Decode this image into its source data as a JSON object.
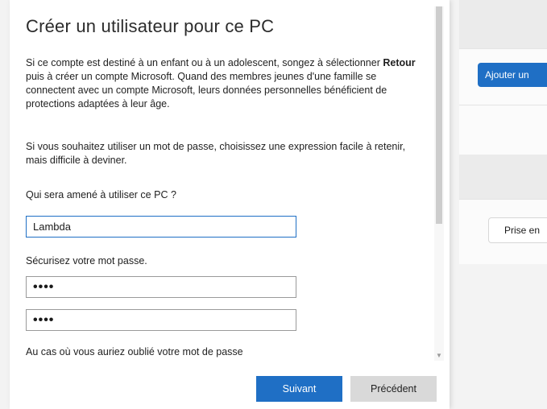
{
  "background": {
    "primary_button": "Ajouter un",
    "secondary_button": "Prise en"
  },
  "dialog": {
    "title": "Créer un utilisateur pour ce PC",
    "intro": {
      "line1_prefix": "Si ce compte est destiné à un enfant ou à un adolescent, songez à sélectionner ",
      "line1_bold": "Retour",
      "line2": "puis à créer un compte Microsoft. Quand des membres jeunes d'une famille se",
      "line3": "connectent avec un compte Microsoft, leurs données personnelles bénéficient de",
      "line4": "protections adaptées à leur âge."
    },
    "password_hint": {
      "line1": "Si vous souhaitez utiliser un mot de passe, choisissez une expression facile à retenir,",
      "line2": "mais difficile à deviner."
    },
    "user_label": "Qui sera amené à utiliser ce PC ?",
    "user_value": "Lambda",
    "password_label": "Sécurisez votre mot passe.",
    "password_value": "••••",
    "password_confirm_value": "••••",
    "forgot_label": "Au cas où vous auriez oublié votre mot de passe",
    "next_button": "Suivant",
    "prev_button": "Précédent"
  },
  "colors": {
    "accent": "#1f6fc5",
    "secondary_button": "#d9d9d9"
  },
  "icons": {
    "scroll_down": "chevron-down-icon"
  }
}
